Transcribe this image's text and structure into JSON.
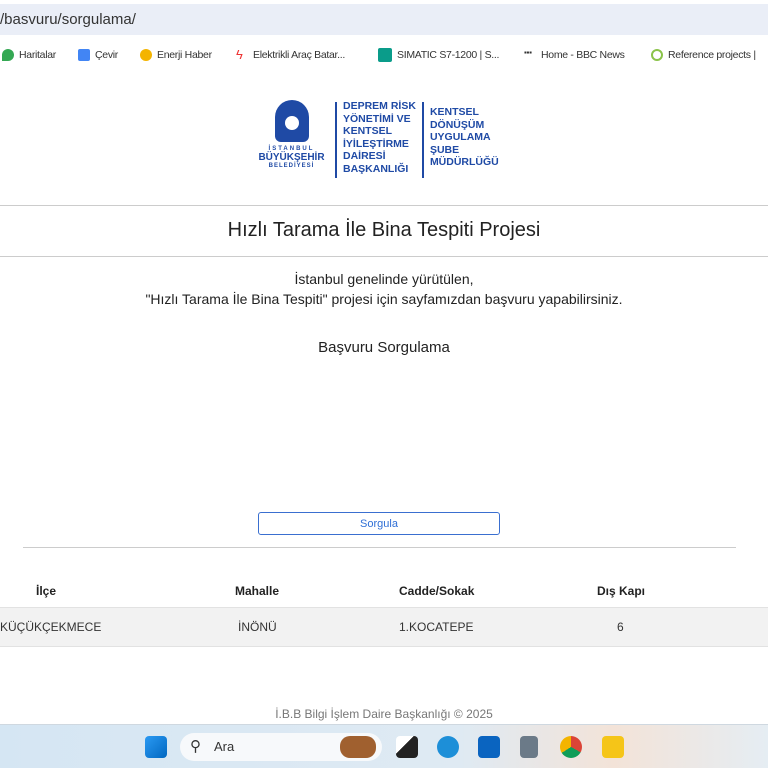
{
  "browser": {
    "url": "/basvuru/sorgulama/",
    "bookmarks": [
      "Haritalar",
      "Çevir",
      "Enerji Haber",
      "Elektrikli Araç Batar...",
      "SIMATIC S7-1200 | S...",
      "Home - BBC News",
      "Reference projects |"
    ]
  },
  "logo": {
    "ibb": [
      "İSTANBUL",
      "BÜYÜKŞEHİR",
      "BELEDİYESİ"
    ],
    "dept": [
      "DEPREM RİSK",
      "YÖNETİMİ VE",
      "KENTSEL",
      "İYİLEŞTİRME",
      "DAİRESİ",
      "BAŞKANLIĞI"
    ],
    "unit": [
      "KENTSEL",
      "DÖNÜŞÜM",
      "UYGULAMA",
      "ŞUBE",
      "MÜDÜRLÜĞÜ"
    ]
  },
  "page": {
    "title": "Hızlı Tarama İle Bina Tespiti Projesi",
    "intro1": "İstanbul genelinde yürütülen,",
    "intro2": "\"Hızlı Tarama İle Bina Tespiti\" projesi için sayfamızdan başvuru yapabilirsiniz.",
    "section": "Başvuru Sorgulama",
    "button": "Sorgula"
  },
  "table": {
    "headers": [
      "İlçe",
      "Mahalle",
      "Cadde/Sokak",
      "Dış Kapı"
    ],
    "rows": [
      [
        "KÜÇÜKÇEKMECE",
        "İNÖNÜ",
        "1.KOCATEPE",
        "6"
      ]
    ]
  },
  "footer": "İ.B.B Bilgi İşlem Daire Başkanlığı © 2025",
  "taskbar": {
    "search_placeholder": "Ara"
  },
  "colors": {
    "brand": "#1f4aa5",
    "button": "#2f6fd6"
  }
}
